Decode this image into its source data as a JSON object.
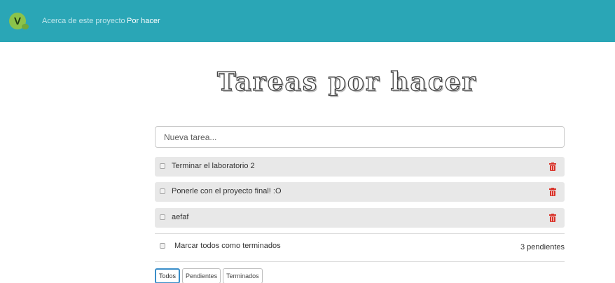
{
  "navbar": {
    "logo_letter": "V",
    "links": [
      {
        "label": "Acerca de este proyecto",
        "active": false
      },
      {
        "label": "Por hacer",
        "active": true
      }
    ],
    "background_color": "#2aa6b6"
  },
  "page": {
    "title": "Tareas por hacer"
  },
  "new_task": {
    "placeholder": "Nueva tarea...",
    "value": ""
  },
  "tasks": [
    {
      "label": "Terminar el laboratorio 2",
      "done": false,
      "delete_icon": "trash-icon"
    },
    {
      "label": "Ponerle con el proyecto final! :O",
      "done": false,
      "delete_icon": "trash-icon"
    },
    {
      "label": "aefaf",
      "done": false,
      "delete_icon": "trash-icon"
    }
  ],
  "footer": {
    "mark_all_label": "Marcar todos como terminados",
    "pending_count": "3 pendientes"
  },
  "filters": [
    {
      "label": "Todos",
      "active": true
    },
    {
      "label": "Pendientes",
      "active": false
    },
    {
      "label": "Terminados",
      "active": false
    }
  ],
  "colors": {
    "accent": "#2aa6b6",
    "delete": "#d9342b",
    "task_bg": "#e8e8e8",
    "filter_active_border": "#3a8ec9"
  }
}
